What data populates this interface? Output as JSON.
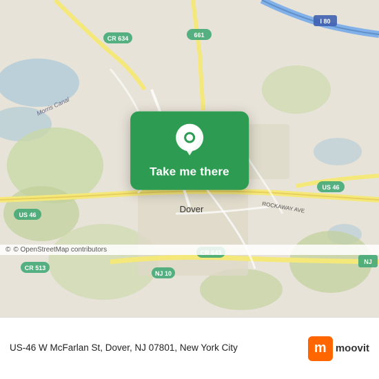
{
  "map": {
    "alt": "Map of Dover, NJ area"
  },
  "cta": {
    "label": "Take me there"
  },
  "attribution": {
    "text": "© OpenStreetMap contributors"
  },
  "info": {
    "address": "US-46 W McFarlan St, Dover, NJ 07801, New York\nCity"
  },
  "moovit": {
    "name": "moovit",
    "letter": "m"
  },
  "icons": {
    "pin": "location-pin-icon"
  }
}
